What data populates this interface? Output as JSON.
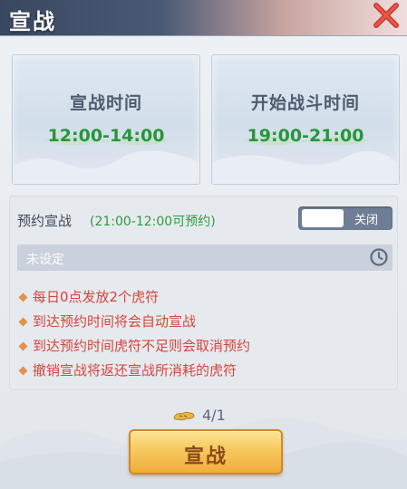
{
  "header": {
    "title": "宣战"
  },
  "cards": [
    {
      "label": "宣战时间",
      "time": "12:00-14:00"
    },
    {
      "label": "开始战斗时间",
      "time": "19:00-21:00"
    }
  ],
  "reserve": {
    "title": "预约宣战",
    "hint": "(21:00-12:00可预约)",
    "toggle_label": "关闭",
    "toggle_on": false,
    "selector_value": "未设定",
    "rules": [
      "每日0点发放2个虎符",
      "到达预约时间将会自动宣战",
      "到达预约时间虎符不足则会取消预约",
      "撤销宣战将返还宣战所消耗的虎符"
    ]
  },
  "cost": {
    "icon": "tiger-tally-icon",
    "text": "4/1"
  },
  "declare_button": {
    "label": "宣战"
  },
  "colors": {
    "time_green": "#26963a",
    "rule_red": "#d6453b",
    "button_gold": "#f7c85e"
  }
}
